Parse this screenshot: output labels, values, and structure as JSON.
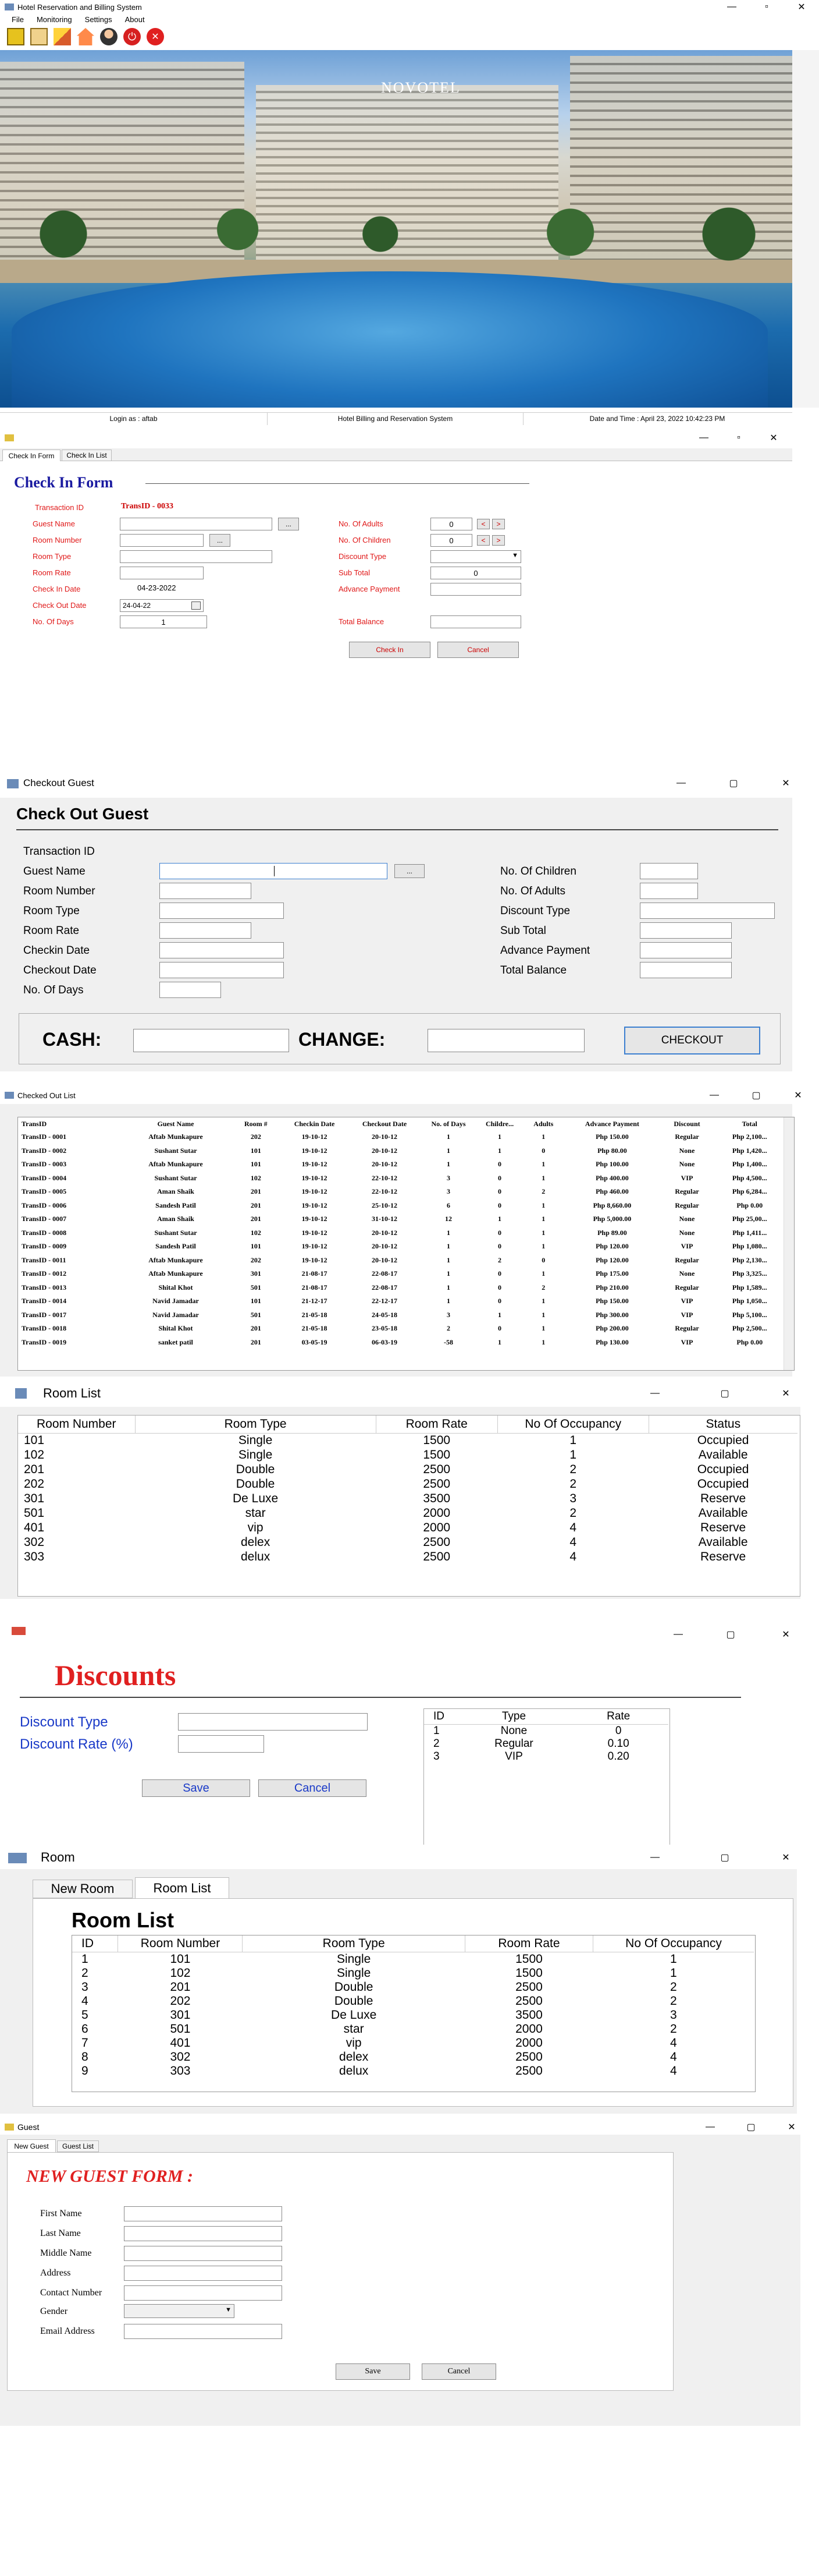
{
  "main": {
    "title": "Hotel Reservation and Billing System",
    "menu": [
      "File",
      "Monitoring",
      "Settings",
      "About"
    ],
    "brand": "NOVOTEL",
    "status": {
      "login": "Login as : aftab",
      "system": "Hotel Billing and Reservation System",
      "datetime": "Date and Time : April 23, 2022  10:42:23 PM"
    }
  },
  "checkin": {
    "tabs": [
      "Check In Form",
      "Check In List"
    ],
    "heading": "Check In Form",
    "trans_label": "Transaction ID",
    "trans_value": "TransID - 0033",
    "labels_left": [
      "Guest Name",
      "Room Number",
      "Room Type",
      "Room Rate",
      "Check In Date",
      "Check Out Date",
      "No. Of Days"
    ],
    "checkin_date": "04-23-2022",
    "checkout_date": "24-04-22",
    "days": "1",
    "browse": "...",
    "labels_right": [
      "No. Of Adults",
      "No. Of Children",
      "Discount Type",
      "Sub Total",
      "Advance Payment",
      "Total Balance"
    ],
    "adults": "0",
    "children": "0",
    "subtotal": "0",
    "btn_checkin": "Check In",
    "btn_cancel": "Cancel"
  },
  "checkout": {
    "title": "Checkout Guest",
    "heading": "Check Out Guest",
    "labels_left": [
      "Transaction ID",
      "Guest Name",
      "Room Number",
      "Room Type",
      "Room Rate",
      "Checkin Date",
      "Checkout Date",
      "No. Of Days"
    ],
    "labels_right": [
      "No. Of Children",
      "No. Of Adults",
      "Discount Type",
      "Sub Total",
      "Advance Payment",
      "Total Balance"
    ],
    "browse": "...",
    "cash": "CASH:",
    "change": "CHANGE:",
    "btn": "CHECKOUT"
  },
  "checkedout": {
    "title": "Checked Out List",
    "columns": [
      "TransID",
      "Guest Name",
      "Room #",
      "Checkin Date",
      "Checkout Date",
      "No. of Days",
      "Childre...",
      "Adults",
      "Advance Payment",
      "Discount",
      "Total"
    ],
    "rows": [
      [
        "TransID - 0001",
        "Aftab Munkapure",
        "202",
        "19-10-12",
        "20-10-12",
        "1",
        "1",
        "1",
        "Php 150.00",
        "Regular",
        "Php 2,100..."
      ],
      [
        "TransID - 0002",
        "Sushant Sutar",
        "101",
        "19-10-12",
        "20-10-12",
        "1",
        "1",
        "0",
        "Php 80.00",
        "None",
        "Php 1,420..."
      ],
      [
        "TransID - 0003",
        "Aftab Munkapure",
        "101",
        "19-10-12",
        "20-10-12",
        "1",
        "0",
        "1",
        "Php 100.00",
        "None",
        "Php 1,400..."
      ],
      [
        "TransID - 0004",
        "Sushant Sutar",
        "102",
        "19-10-12",
        "22-10-12",
        "3",
        "0",
        "1",
        "Php 400.00",
        "VIP",
        "Php 4,500..."
      ],
      [
        "TransID - 0005",
        "Aman Shaik",
        "201",
        "19-10-12",
        "22-10-12",
        "3",
        "0",
        "2",
        "Php 460.00",
        "Regular",
        "Php 6,284..."
      ],
      [
        "TransID - 0006",
        "Sandesh Patil",
        "201",
        "19-10-12",
        "25-10-12",
        "6",
        "0",
        "1",
        "Php 8,660.00",
        "Regular",
        "Php 0.00"
      ],
      [
        "TransID - 0007",
        "Aman Shaik",
        "201",
        "19-10-12",
        "31-10-12",
        "12",
        "1",
        "1",
        "Php 5,000.00",
        "None",
        "Php 25,00..."
      ],
      [
        "TransID - 0008",
        "Sushant Sutar",
        "102",
        "19-10-12",
        "20-10-12",
        "1",
        "0",
        "1",
        "Php 89.00",
        "None",
        "Php 1,411..."
      ],
      [
        "TransID - 0009",
        "Sandesh Patil",
        "101",
        "19-10-12",
        "20-10-12",
        "1",
        "0",
        "1",
        "Php 120.00",
        "VIP",
        "Php 1,080..."
      ],
      [
        "TransID - 0011",
        "Aftab Munkapure",
        "202",
        "19-10-12",
        "20-10-12",
        "1",
        "2",
        "0",
        "Php 120.00",
        "Regular",
        "Php 2,130..."
      ],
      [
        "TransID - 0012",
        "Aftab Munkapure",
        "301",
        "21-08-17",
        "22-08-17",
        "1",
        "0",
        "1",
        "Php 175.00",
        "None",
        "Php 3,325..."
      ],
      [
        "TransID - 0013",
        "Shital Khot",
        "501",
        "21-08-17",
        "22-08-17",
        "1",
        "0",
        "2",
        "Php 210.00",
        "Regular",
        "Php 1,589..."
      ],
      [
        "TransID - 0014",
        "Navid Jamadar",
        "101",
        "21-12-17",
        "22-12-17",
        "1",
        "0",
        "1",
        "Php 150.00",
        "VIP",
        "Php 1,050..."
      ],
      [
        "TransID - 0017",
        "Navid Jamadar",
        "501",
        "21-05-18",
        "24-05-18",
        "3",
        "1",
        "1",
        "Php 300.00",
        "VIP",
        "Php 5,100..."
      ],
      [
        "TransID - 0018",
        "Shital Khot",
        "201",
        "21-05-18",
        "23-05-18",
        "2",
        "0",
        "1",
        "Php 200.00",
        "Regular",
        "Php 2,500..."
      ],
      [
        "TransID - 0019",
        "sanket patil",
        "201",
        "03-05-19",
        "06-03-19",
        "-58",
        "1",
        "1",
        "Php 130.00",
        "VIP",
        "Php 0.00"
      ]
    ]
  },
  "roomlist": {
    "title": "Room List",
    "columns": [
      "Room Number",
      "Room Type",
      "Room Rate",
      "No Of Occupancy",
      "Status"
    ],
    "rows": [
      [
        "101",
        "Single",
        "1500",
        "1",
        "Occupied"
      ],
      [
        "102",
        "Single",
        "1500",
        "1",
        "Available"
      ],
      [
        "201",
        "Double",
        "2500",
        "2",
        "Occupied"
      ],
      [
        "202",
        "Double",
        "2500",
        "2",
        "Occupied"
      ],
      [
        "301",
        "De Luxe",
        "3500",
        "3",
        "Reserve"
      ],
      [
        "501",
        "star",
        "2000",
        "2",
        "Available"
      ],
      [
        "401",
        "vip",
        "2000",
        "4",
        "Reserve"
      ],
      [
        "302",
        "delex",
        "2500",
        "4",
        "Available"
      ],
      [
        "303",
        "delux",
        "2500",
        "4",
        "Reserve"
      ]
    ]
  },
  "discounts": {
    "heading": "Discounts",
    "type_label": "Discount Type",
    "rate_label": "Discount Rate (%)",
    "save": "Save",
    "cancel": "Cancel",
    "columns": [
      "ID",
      "Type",
      "Rate"
    ],
    "rows": [
      [
        "1",
        "None",
        "0"
      ],
      [
        "2",
        "Regular",
        "0.10"
      ],
      [
        "3",
        "VIP",
        "0.20"
      ]
    ]
  },
  "room": {
    "title": "Room",
    "tabs": [
      "New Room",
      "Room List"
    ],
    "heading": "Room List",
    "columns": [
      "ID",
      "Room Number",
      "Room Type",
      "Room Rate",
      "No Of Occupancy"
    ],
    "rows": [
      [
        "1",
        "101",
        "Single",
        "1500",
        "1"
      ],
      [
        "2",
        "102",
        "Single",
        "1500",
        "1"
      ],
      [
        "3",
        "201",
        "Double",
        "2500",
        "2"
      ],
      [
        "4",
        "202",
        "Double",
        "2500",
        "2"
      ],
      [
        "5",
        "301",
        "De Luxe",
        "3500",
        "3"
      ],
      [
        "6",
        "501",
        "star",
        "2000",
        "2"
      ],
      [
        "7",
        "401",
        "vip",
        "2000",
        "4"
      ],
      [
        "8",
        "302",
        "delex",
        "2500",
        "4"
      ],
      [
        "9",
        "303",
        "delux",
        "2500",
        "4"
      ]
    ]
  },
  "guest": {
    "title": "Guest",
    "tabs": [
      "New Guest",
      "Guest List"
    ],
    "heading": "NEW GUEST FORM :",
    "labels": [
      "First Name",
      "Last Name",
      "Middle Name",
      "Address",
      "Contact Number",
      "Gender",
      "Email Address"
    ],
    "save": "Save",
    "cancel": "Cancel"
  }
}
